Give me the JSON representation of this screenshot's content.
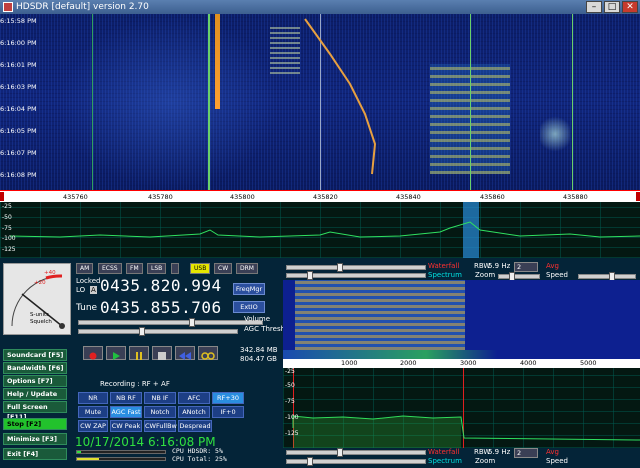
{
  "window": {
    "title": "HDSDR [default]  version 2.70",
    "btn_min": "–",
    "btn_max": "□",
    "btn_close": "✕"
  },
  "waterfall": {
    "times": [
      "6:15:58 PM",
      "6:16:00 PM",
      "6:16:01 PM",
      "6:16:03 PM",
      "6:16:04 PM",
      "6:16:05 PM",
      "6:16:07 PM",
      "6:16:08 PM"
    ]
  },
  "freq_axis": {
    "ticks": [
      "435760",
      "435780",
      "435800",
      "435820",
      "435840",
      "435860",
      "435880"
    ]
  },
  "spectrum": {
    "db": [
      "-25",
      "-50",
      "-75",
      "-100",
      "-125"
    ]
  },
  "modes": [
    "AM",
    "ECSS",
    "FM",
    "LSB",
    "USB",
    "CW",
    "DRM"
  ],
  "active_mode": "USB",
  "lo": {
    "label_top": "Locked",
    "label": "LO",
    "badge": "A",
    "value": "0435.820.994"
  },
  "tune": {
    "label": "Tune",
    "value": "0435.855.706"
  },
  "buttons": {
    "freqmgr": "FreqMgr",
    "extio": "ExtIO"
  },
  "labels": {
    "volume": "Volume",
    "agc": "AGC Thresh.",
    "mem1": "342.84 MB",
    "mem2": "804.47 GB",
    "recording": "Recording : RF + AF",
    "smeter_text": "S-units",
    "smeter_sub": "Squelch",
    "smeter_p20": "+20",
    "smeter_p40": "+40"
  },
  "side_buttons": [
    "Soundcard [F5]",
    "Bandwidth [F6]",
    "Options [F7]",
    "Help / Update [F1]",
    "Full Screen [F11]",
    "Stop [F2]",
    "Minimize [F3]",
    "Exit [F4]"
  ],
  "dsp_row1": [
    "NR",
    "NB RF",
    "NB IF",
    "AFC",
    "RF+30"
  ],
  "dsp_row2": [
    "Mute",
    "AGC Fast",
    "Notch",
    "ANotch",
    "IF+0"
  ],
  "dsp_row3": [
    "CW ZAP",
    "CW Peak",
    "CWFullBw",
    "Despread"
  ],
  "datetime": "10/17/2014 6:16:08 PM",
  "cpu": {
    "hdsdr": "CPU HDSDR: 5%",
    "total": "CPU Total: 25%"
  },
  "controls": {
    "waterfall": "Waterfall",
    "spectrum": "Spectrum",
    "zoom": "Zoom",
    "speed": "Speed",
    "rbw": "RBW",
    "rbw_value": "5.9 Hz",
    "avg": "Avg",
    "avg_value": "2"
  },
  "axis2": {
    "ticks": [
      "1000",
      "2000",
      "3000",
      "4000",
      "5000"
    ]
  },
  "spec2_db": [
    "-25",
    "-50",
    "-75",
    "-100",
    "-125"
  ],
  "colors": {
    "accent_red": "#ff3030",
    "accent_cyan": "#00e0e0",
    "btn_blue": "#1d3f85"
  }
}
